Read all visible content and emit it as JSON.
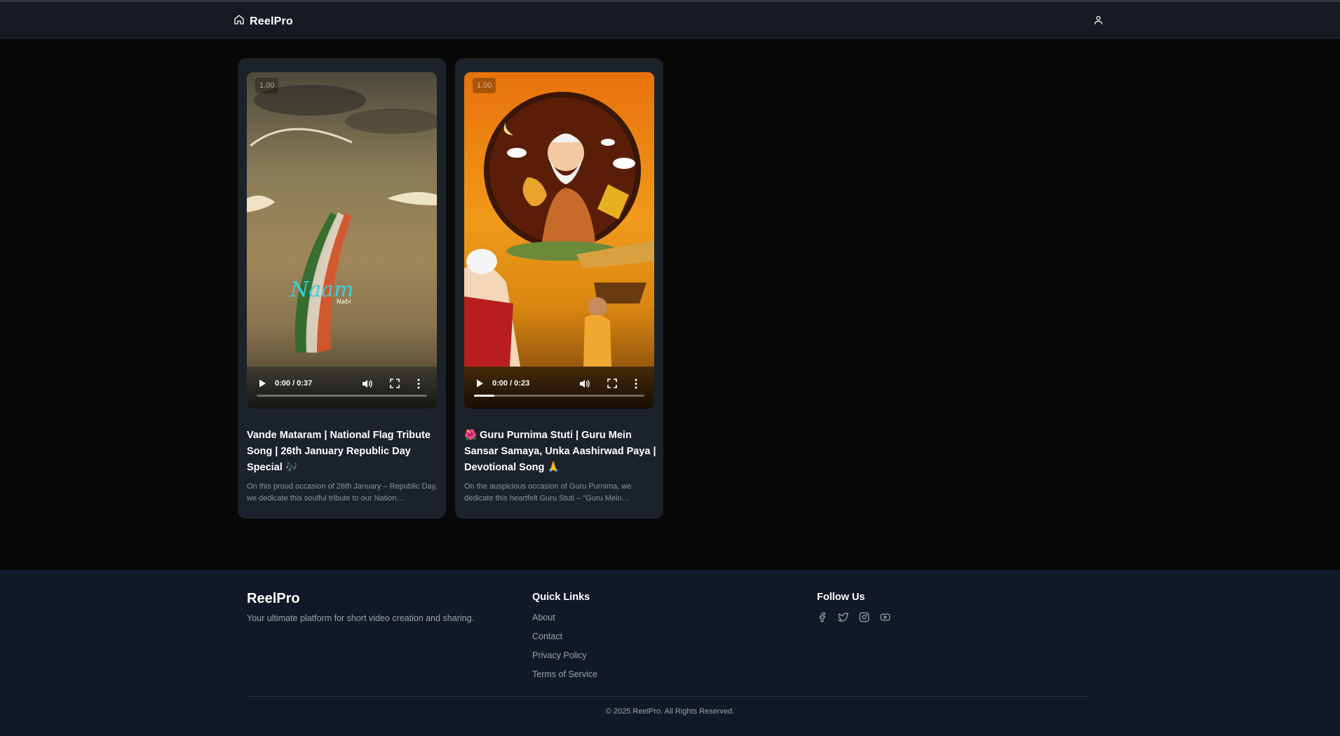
{
  "nav": {
    "brand": "ReelPro",
    "home_icon": "home-icon",
    "user_icon": "user-icon"
  },
  "videos": [
    {
      "speed": "1.00",
      "time": "0:00 / 0:37",
      "progress": 0,
      "title": "Vande Mataram | National Flag Tribute Song | 26th January Republic Day Special 🎶",
      "description": "On this proud occasion of 26th January – Republic Day, we dedicate this soulful tribute to our Nation…"
    },
    {
      "speed": "1.00",
      "time": "0:00 / 0:23",
      "progress": 0.12,
      "title": "🌺 Guru Purnima Stuti | Guru Mein Sansar Samaya, Unka Aashirwad Paya | Devotional Song 🙏",
      "description": "On the auspicious occasion of Guru Purnima, we dedicate this heartfelt Guru Stuti – \"Guru Mein…"
    }
  ],
  "footer": {
    "brand": "ReelPro",
    "tagline": "Your ultimate platform for short video creation and sharing.",
    "quick_links_heading": "Quick Links",
    "quick_links": [
      "About",
      "Contact",
      "Privacy Policy",
      "Terms of Service"
    ],
    "follow_heading": "Follow Us",
    "socials": [
      "facebook-icon",
      "twitter-icon",
      "instagram-icon",
      "youtube-icon"
    ],
    "copyright": "© 2025 ReelPro. All Rights Reserved."
  }
}
